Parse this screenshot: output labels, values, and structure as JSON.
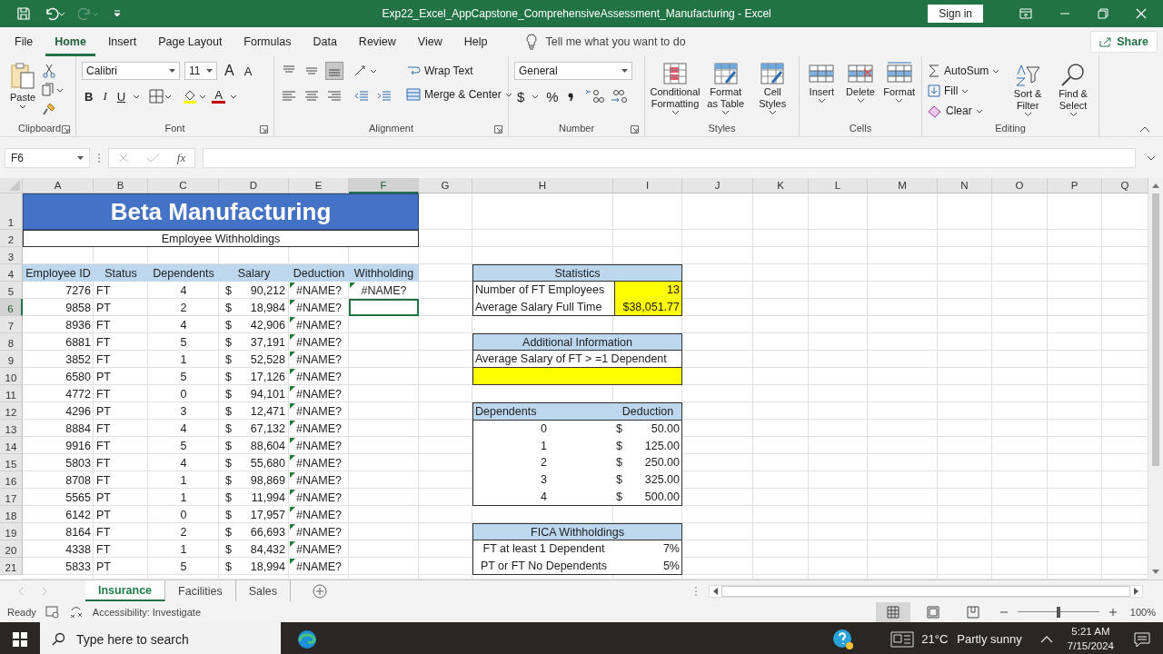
{
  "title_bar": {
    "title": "Exp22_Excel_AppCapstone_ComprehensiveAssessment_Manufacturing  -  Excel",
    "sign_in": "Sign in",
    "redo_disabled": true
  },
  "menu": {
    "tabs": [
      {
        "label": "File",
        "selected": false
      },
      {
        "label": "Home",
        "selected": true
      },
      {
        "label": "Insert",
        "selected": false
      },
      {
        "label": "Page Layout",
        "selected": false
      },
      {
        "label": "Formulas",
        "selected": false
      },
      {
        "label": "Data",
        "selected": false
      },
      {
        "label": "Review",
        "selected": false
      },
      {
        "label": "View",
        "selected": false
      },
      {
        "label": "Help",
        "selected": false
      }
    ],
    "tell_me": "Tell me what you want to do",
    "share": "Share"
  },
  "ribbon": {
    "clipboard": {
      "label": "Clipboard",
      "paste": "Paste"
    },
    "font": {
      "label": "Font",
      "font_name": "Calibri",
      "font_size": "11",
      "grow": "A",
      "shrink": "A",
      "bold": "B",
      "italic": "I",
      "underline": "U",
      "font_color": "A"
    },
    "alignment": {
      "label": "Alignment",
      "vertical": [
        {
          "selected": false
        },
        {
          "selected": false
        },
        {
          "selected": true
        }
      ],
      "wrap_text": "Wrap Text",
      "merge": "Merge & Center"
    },
    "number": {
      "label": "Number",
      "format": "General",
      "currency": "$",
      "percent": "%"
    },
    "styles": {
      "label": "Styles",
      "buttons": [
        "Conditional Formatting",
        "Format as Table",
        "Cell Styles"
      ]
    },
    "cells": {
      "label": "Cells",
      "buttons": [
        "Insert",
        "Delete",
        "Format"
      ]
    },
    "editing": {
      "label": "Editing",
      "autosum": "AutoSum",
      "fill": "Fill",
      "clear": "Clear",
      "buttons": [
        "Sort & Filter",
        "Find & Select"
      ]
    }
  },
  "formula_bar": {
    "name_box": "F6",
    "fx": "fx"
  },
  "sheet": {
    "columns": [
      {
        "label": "A",
        "selected": false
      },
      {
        "label": "B",
        "selected": false
      },
      {
        "label": "C",
        "selected": false
      },
      {
        "label": "D",
        "selected": false
      },
      {
        "label": "E",
        "selected": false
      },
      {
        "label": "F",
        "selected": true
      },
      {
        "label": "G",
        "selected": false
      },
      {
        "label": "H",
        "selected": false
      },
      {
        "label": "I",
        "selected": false
      },
      {
        "label": "J",
        "selected": false
      },
      {
        "label": "K",
        "selected": false
      },
      {
        "label": "L",
        "selected": false
      },
      {
        "label": "M",
        "selected": false
      },
      {
        "label": "N",
        "selected": false
      },
      {
        "label": "O",
        "selected": false
      },
      {
        "label": "P",
        "selected": false
      },
      {
        "label": "Q",
        "selected": false
      }
    ],
    "rows": [
      {
        "label": "1",
        "selected": false
      },
      {
        "label": "2",
        "selected": false
      },
      {
        "label": "3",
        "selected": false
      },
      {
        "label": "4",
        "selected": false
      },
      {
        "label": "5",
        "selected": false
      },
      {
        "label": "6",
        "selected": true
      },
      {
        "label": "7",
        "selected": false
      },
      {
        "label": "8",
        "selected": false
      },
      {
        "label": "9",
        "selected": false
      },
      {
        "label": "10",
        "selected": false
      },
      {
        "label": "11",
        "selected": false
      },
      {
        "label": "12",
        "selected": false
      },
      {
        "label": "13",
        "selected": false
      },
      {
        "label": "14",
        "selected": false
      },
      {
        "label": "15",
        "selected": false
      },
      {
        "label": "16",
        "selected": false
      },
      {
        "label": "17",
        "selected": false
      },
      {
        "label": "18",
        "selected": false
      },
      {
        "label": "19",
        "selected": false
      },
      {
        "label": "20",
        "selected": false
      },
      {
        "label": "21",
        "selected": false
      }
    ],
    "title": "Beta Manufacturing",
    "subtitle": "Employee Withholdings",
    "headers": [
      "Employee ID",
      "Status",
      "Dependents",
      "Salary",
      "Deduction",
      "Withholding"
    ],
    "records": [
      {
        "id": "7276",
        "status": "FT",
        "dependents": "4",
        "currency": "$",
        "salary": "90,212",
        "deduction": "#NAME?",
        "deduction_flag": true,
        "withholding": "#NAME?",
        "withholding_flag": true,
        "selected": false
      },
      {
        "id": "9858",
        "status": "PT",
        "dependents": "2",
        "currency": "$",
        "salary": "18,984",
        "deduction": "#NAME?",
        "deduction_flag": true,
        "withholding_flag": false,
        "selected": true
      },
      {
        "id": "8936",
        "status": "FT",
        "dependents": "4",
        "currency": "$",
        "salary": "42,906",
        "deduction": "#NAME?",
        "deduction_flag": true,
        "withholding_flag": false,
        "selected": false
      },
      {
        "id": "6881",
        "status": "FT",
        "dependents": "5",
        "currency": "$",
        "salary": "37,191",
        "deduction": "#NAME?",
        "deduction_flag": true,
        "withholding_flag": false,
        "selected": false
      },
      {
        "id": "3852",
        "status": "FT",
        "dependents": "1",
        "currency": "$",
        "salary": "52,528",
        "deduction": "#NAME?",
        "deduction_flag": true,
        "withholding_flag": false,
        "selected": false
      },
      {
        "id": "6580",
        "status": "PT",
        "dependents": "5",
        "currency": "$",
        "salary": "17,126",
        "deduction": "#NAME?",
        "deduction_flag": true,
        "withholding_flag": false,
        "selected": false
      },
      {
        "id": "4772",
        "status": "FT",
        "dependents": "0",
        "currency": "$",
        "salary": "94,101",
        "deduction": "#NAME?",
        "deduction_flag": true,
        "withholding_flag": false,
        "selected": false
      },
      {
        "id": "4296",
        "status": "PT",
        "dependents": "3",
        "currency": "$",
        "salary": "12,471",
        "deduction": "#NAME?",
        "deduction_flag": true,
        "withholding_flag": false,
        "selected": false
      },
      {
        "id": "8884",
        "status": "FT",
        "dependents": "4",
        "currency": "$",
        "salary": "67,132",
        "deduction": "#NAME?",
        "deduction_flag": true,
        "withholding_flag": false,
        "selected": false
      },
      {
        "id": "9916",
        "status": "FT",
        "dependents": "5",
        "currency": "$",
        "salary": "88,604",
        "deduction": "#NAME?",
        "deduction_flag": true,
        "withholding_flag": false,
        "selected": false
      },
      {
        "id": "5803",
        "status": "FT",
        "dependents": "4",
        "currency": "$",
        "salary": "55,680",
        "deduction": "#NAME?",
        "deduction_flag": true,
        "withholding_flag": false,
        "selected": false
      },
      {
        "id": "8708",
        "status": "FT",
        "dependents": "1",
        "currency": "$",
        "salary": "98,869",
        "deduction": "#NAME?",
        "deduction_flag": true,
        "withholding_flag": false,
        "selected": false
      },
      {
        "id": "5565",
        "status": "PT",
        "dependents": "1",
        "currency": "$",
        "salary": "11,994",
        "deduction": "#NAME?",
        "deduction_flag": true,
        "withholding_flag": false,
        "selected": false
      },
      {
        "id": "6142",
        "status": "PT",
        "dependents": "0",
        "currency": "$",
        "salary": "17,957",
        "deduction": "#NAME?",
        "deduction_flag": true,
        "withholding_flag": false,
        "selected": false
      },
      {
        "id": "8164",
        "status": "FT",
        "dependents": "2",
        "currency": "$",
        "salary": "66,693",
        "deduction": "#NAME?",
        "deduction_flag": true,
        "withholding_flag": false,
        "selected": false
      },
      {
        "id": "4338",
        "status": "FT",
        "dependents": "1",
        "currency": "$",
        "salary": "84,432",
        "deduction": "#NAME?",
        "deduction_flag": true,
        "withholding_flag": false,
        "selected": false
      },
      {
        "id": "5833",
        "status": "PT",
        "dependents": "5",
        "currency": "$",
        "salary": "18,994",
        "deduction": "#NAME?",
        "deduction_flag": true,
        "withholding_flag": false,
        "selected": false
      }
    ],
    "statistics": {
      "title": "Statistics",
      "rows": [
        {
          "label": "Number of FT Employees",
          "value": "13"
        },
        {
          "label": "Average Salary Full Time",
          "value": "$38,051.77"
        }
      ]
    },
    "additional": {
      "title": "Additional Information",
      "label": "Average Salary of FT > =1 Dependent"
    },
    "deductions": {
      "headers": [
        "Dependents",
        "Deduction"
      ],
      "rows": [
        {
          "dependents": "0",
          "currency": "$",
          "amount": "50.00"
        },
        {
          "dependents": "1",
          "currency": "$",
          "amount": "125.00"
        },
        {
          "dependents": "2",
          "currency": "$",
          "amount": "250.00"
        },
        {
          "dependents": "3",
          "currency": "$",
          "amount": "325.00"
        },
        {
          "dependents": "4",
          "currency": "$",
          "amount": "500.00"
        }
      ]
    },
    "fica": {
      "title": "FICA Withholdings",
      "rows": [
        {
          "label": "FT at least 1 Dependent",
          "rate": "7%"
        },
        {
          "label": "PT or FT No Dependents",
          "rate": "5%"
        }
      ]
    }
  },
  "sheet_tabs": [
    {
      "label": "Insurance",
      "selected": true
    },
    {
      "label": "Facilities",
      "selected": false
    },
    {
      "label": "Sales",
      "selected": false
    }
  ],
  "status_bar": {
    "ready": "Ready",
    "accessibility": "Accessibility: Investigate",
    "views": [
      {
        "selected": true
      },
      {
        "selected": false
      },
      {
        "selected": false
      }
    ],
    "zoom": {
      "level": 0.5,
      "reading": "100%"
    }
  },
  "taskbar": {
    "search_placeholder": "Type here to search",
    "temperature": "21°C",
    "weather": "Partly sunny",
    "time": "5:21 AM",
    "date": "7/15/2024"
  }
}
